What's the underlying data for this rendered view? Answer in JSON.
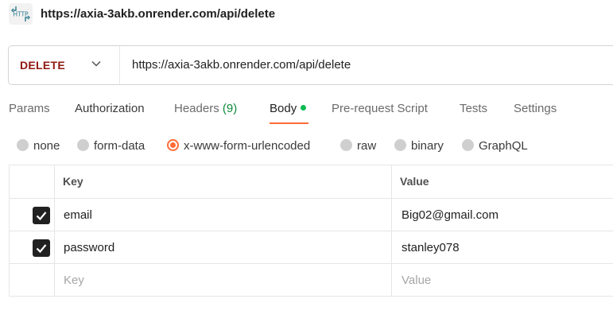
{
  "title": {
    "icon": "http-icon",
    "icon_text": "HTTP",
    "url": "https://axia-3akb.onrender.com/api/delete"
  },
  "request": {
    "method": "DELETE",
    "url": "https://axia-3akb.onrender.com/api/delete"
  },
  "tabs": [
    {
      "label": "Params"
    },
    {
      "label": "Authorization"
    },
    {
      "label": "Headers",
      "count": "(9)"
    },
    {
      "label": "Body",
      "active": true,
      "indicator": "green-dot"
    },
    {
      "label": "Pre-request Script"
    },
    {
      "label": "Tests"
    },
    {
      "label": "Settings"
    }
  ],
  "body_modes": [
    {
      "label": "none"
    },
    {
      "label": "form-data"
    },
    {
      "label": "x-www-form-urlencoded",
      "selected": true
    },
    {
      "label": "raw"
    },
    {
      "label": "binary"
    },
    {
      "label": "GraphQL"
    }
  ],
  "table": {
    "headers": {
      "key": "Key",
      "value": "Value"
    },
    "rows": [
      {
        "checked": true,
        "key": "email",
        "value": "Big02@gmail.com"
      },
      {
        "checked": true,
        "key": "password",
        "value": "stanley078"
      }
    ],
    "new_row": {
      "key_placeholder": "Key",
      "value_placeholder": "Value"
    }
  },
  "colors": {
    "accent": "#ff6c37",
    "method": "#8e1a10",
    "headers_count": "#0c8a3a",
    "body_dot": "#0cbb52"
  }
}
